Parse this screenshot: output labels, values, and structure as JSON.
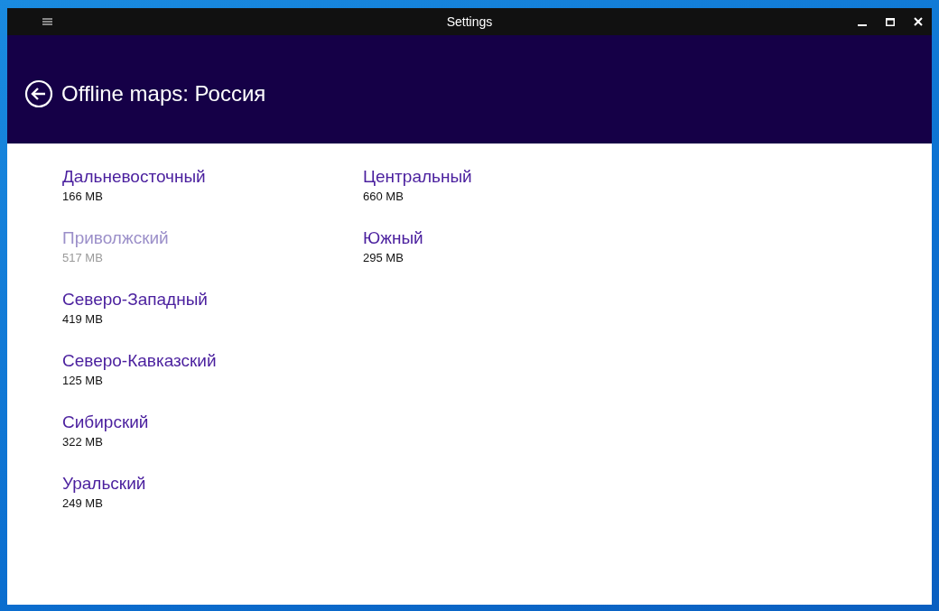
{
  "window": {
    "title": "Settings"
  },
  "header": {
    "title": "Offline maps: Россия"
  },
  "regions": [
    {
      "name": "Дальневосточный",
      "size": "166 MB",
      "disabled": false
    },
    {
      "name": "Приволжский",
      "size": "517 MB",
      "disabled": true
    },
    {
      "name": "Северо-Западный",
      "size": "419 MB",
      "disabled": false
    },
    {
      "name": "Северо-Кавказский",
      "size": "125 MB",
      "disabled": false
    },
    {
      "name": "Сибирский",
      "size": "322 MB",
      "disabled": false
    },
    {
      "name": "Уральский",
      "size": "249 MB",
      "disabled": false
    },
    {
      "name": "Центральный",
      "size": "660 MB",
      "disabled": false
    },
    {
      "name": "Южный",
      "size": "295 MB",
      "disabled": false
    }
  ]
}
